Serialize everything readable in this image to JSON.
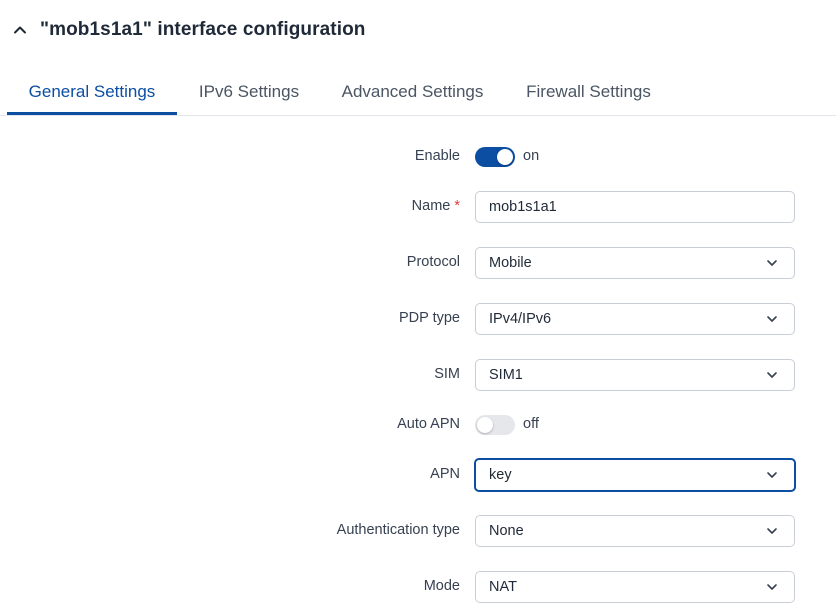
{
  "header": {
    "title": "\"mob1s1a1\" interface configuration",
    "collapse_icon": "chevron-up-icon"
  },
  "tabs": [
    {
      "label": "General Settings",
      "active": true
    },
    {
      "label": "IPv6 Settings",
      "active": false
    },
    {
      "label": "Advanced Settings",
      "active": false
    },
    {
      "label": "Firewall Settings",
      "active": false
    }
  ],
  "form": {
    "enable": {
      "label": "Enable",
      "state": "on"
    },
    "name": {
      "label": "Name",
      "required_mark": "*",
      "value": "mob1s1a1"
    },
    "protocol": {
      "label": "Protocol",
      "value": "Mobile"
    },
    "pdp_type": {
      "label": "PDP type",
      "value": "IPv4/IPv6"
    },
    "sim": {
      "label": "SIM",
      "value": "SIM1"
    },
    "auto_apn": {
      "label": "Auto APN",
      "state": "off"
    },
    "apn": {
      "label": "APN",
      "value": "key"
    },
    "auth_type": {
      "label": "Authentication type",
      "value": "None"
    },
    "mode": {
      "label": "Mode",
      "value": "NAT"
    }
  },
  "colors": {
    "accent": "#0b4ea2",
    "required": "#e23b3b",
    "toggle_off": "#e5e7eb"
  }
}
